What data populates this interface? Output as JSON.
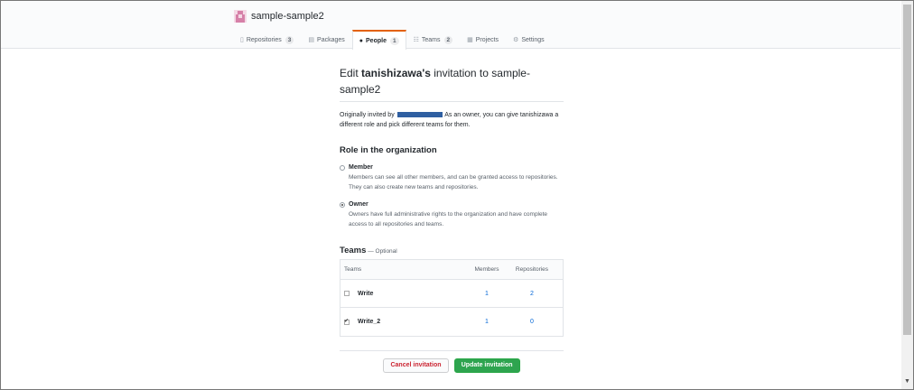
{
  "org": {
    "name": "sample-sample2"
  },
  "tabs": [
    {
      "icon": "▯",
      "label": "Repositories",
      "count": "3"
    },
    {
      "icon": "▤",
      "label": "Packages",
      "count": ""
    },
    {
      "icon": "👤",
      "label": "People",
      "count": "1"
    },
    {
      "icon": "☷",
      "label": "Teams",
      "count": "2"
    },
    {
      "icon": "▦",
      "label": "Projects",
      "count": ""
    },
    {
      "icon": "⚙",
      "label": "Settings",
      "count": ""
    }
  ],
  "page": {
    "title_prefix": "Edit ",
    "title_user": "tanishizawa's",
    "title_suffix": " invitation to sample-sample2",
    "invited_prefix": "Originally invited by",
    "invited_suffix": " As an owner, you can give tanishizawa a different role and pick different teams for them."
  },
  "roles": {
    "heading": "Role in the organization",
    "member": {
      "name": "Member",
      "desc": "Members can see all other members, and can be granted access to repositories. They can also create new teams and repositories."
    },
    "owner": {
      "name": "Owner",
      "desc": "Owners have full administrative rights to the organization and have complete access to all repositories and teams."
    }
  },
  "teams": {
    "heading": "Teams",
    "optional": " — Optional",
    "columns": {
      "teams": "Teams",
      "members": "Members",
      "repos": "Repositories"
    },
    "rows": [
      {
        "name": "Write",
        "members": "1",
        "repos": "2",
        "checked": false
      },
      {
        "name": "Write_2",
        "members": "1",
        "repos": "0",
        "checked": true
      }
    ]
  },
  "actions": {
    "cancel": "Cancel invitation",
    "update": "Update invitation"
  },
  "colors": {
    "accent": "#e36209",
    "link": "#0366d6",
    "primary": "#2ea44f",
    "danger": "#cb2431"
  }
}
